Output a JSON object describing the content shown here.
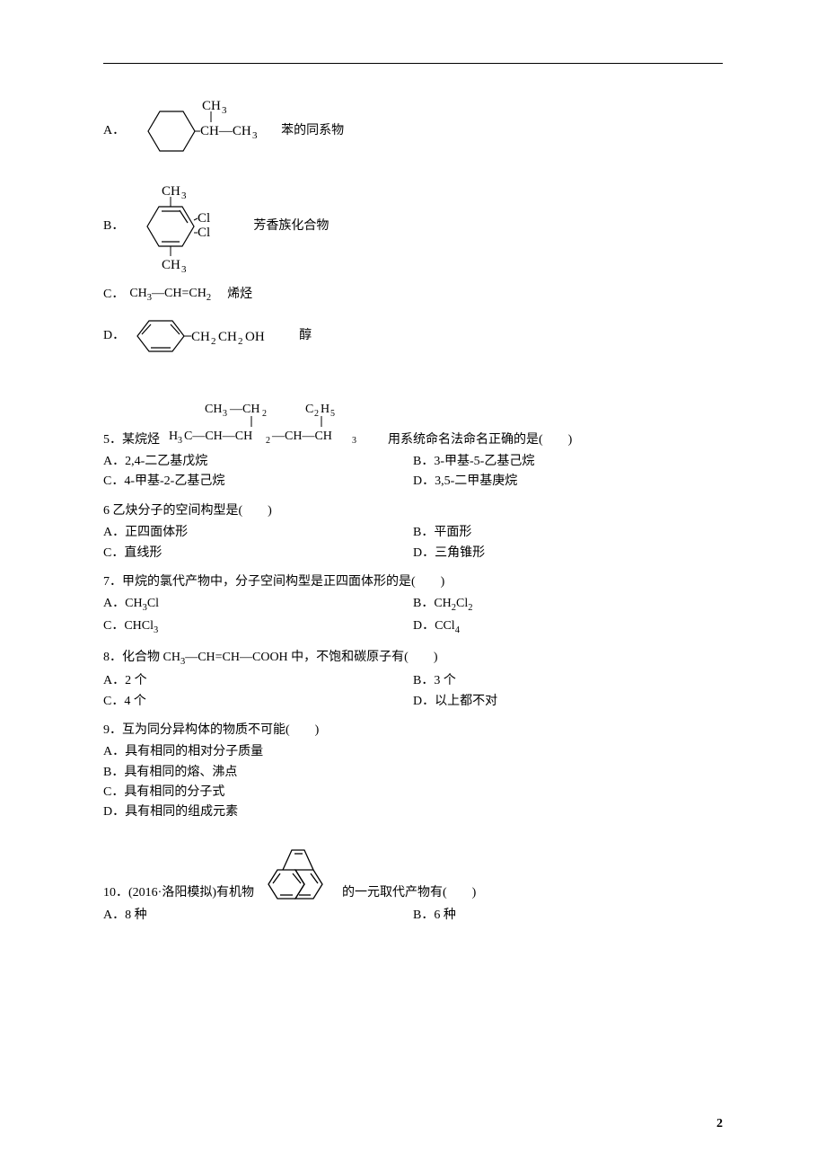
{
  "q4": {
    "optA": {
      "letter": "A．",
      "label": "苯的同系物"
    },
    "optB": {
      "letter": "B．",
      "label": "芳香族化合物"
    },
    "optC": {
      "letter": "C．",
      "formula_pre": "CH",
      "formula_mid": "—CH=CH",
      "label": "烯烃"
    },
    "optD": {
      "letter": "D．",
      "label": "醇"
    }
  },
  "q5": {
    "stem_pre": "5．某烷烃",
    "stem_post": "用系统命名法命名正确的是(　　)",
    "optA": "A．2,4-二乙基戊烷",
    "optB": "B．3-甲基-5-乙基己烷",
    "optC": "C．4-甲基-2-乙基己烷",
    "optD": "D．3,5-二甲基庚烷"
  },
  "q6": {
    "stem": "6 乙炔分子的空间构型是(　　)",
    "optA": "A．正四面体形",
    "optB": "B．平面形",
    "optC": "C．直线形",
    "optD": "D．三角锥形"
  },
  "q7": {
    "stem": "7．甲烷的氯代产物中，分子空间构型是正四面体形的是(　　)",
    "optA_pre": "A．CH",
    "optA_sub": "3",
    "optA_post": "Cl",
    "optB_pre": "B．CH",
    "optB_sub1": "2",
    "optB_mid": "Cl",
    "optB_sub2": "2",
    "optC_pre": "C．CHCl",
    "optC_sub": "3",
    "optD_pre": "D．CCl",
    "optD_sub": "4"
  },
  "q8": {
    "stem_pre": "8．化合物 CH",
    "stem_mid": "—CH=CH—COOH 中，不饱和碳原子有(　　)",
    "optA": "A．2 个",
    "optB": "B．3 个",
    "optC": "C．4 个",
    "optD": "D．以上都不对"
  },
  "q9": {
    "stem": "9．互为同分异构体的物质不可能(　　)",
    "optA": "A．具有相同的相对分子质量",
    "optB": "B．具有相同的熔、沸点",
    "optC": "C．具有相同的分子式",
    "optD": "D．具有相同的组成元素"
  },
  "q10": {
    "stem_pre": "10．(2016·洛阳模拟)有机物",
    "stem_post": "的一元取代产物有(　　)",
    "optA": "A．8 种",
    "optB": "B．6 种"
  },
  "pageNum": "2"
}
